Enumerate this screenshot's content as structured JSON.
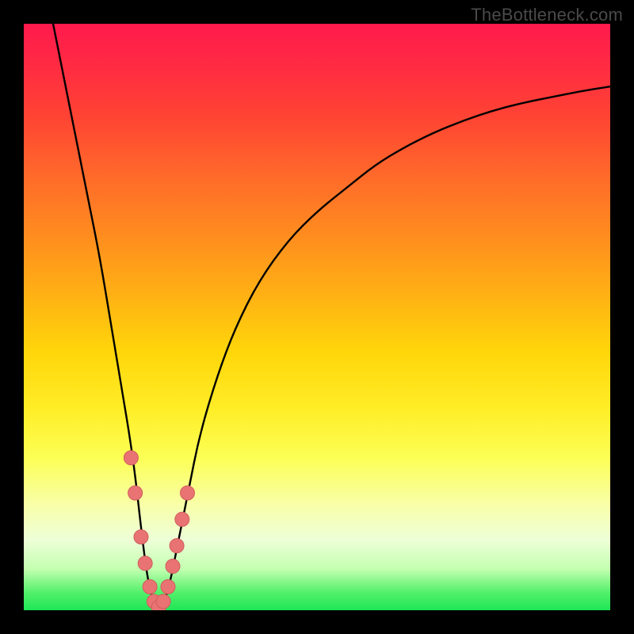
{
  "watermark": "TheBottleneck.com",
  "colors": {
    "frame": "#000000",
    "curve": "#000000",
    "marker_fill": "#e97373",
    "marker_stroke": "#cf5d5d"
  },
  "chart_data": {
    "type": "line",
    "title": "",
    "xlabel": "",
    "ylabel": "",
    "xlim": [
      0,
      100
    ],
    "ylim": [
      0,
      100
    ],
    "grid": false,
    "series": [
      {
        "name": "bottleneck-curve",
        "x_pct": [
          5,
          7,
          9,
          11,
          13,
          15,
          17,
          18,
          19,
          20,
          21,
          22,
          23,
          24,
          25,
          26,
          28,
          30,
          33,
          36,
          40,
          45,
          50,
          55,
          60,
          65,
          70,
          75,
          80,
          85,
          90,
          95,
          100
        ],
        "y_pct": [
          100,
          90,
          80,
          70,
          60,
          48,
          36,
          30,
          23,
          14,
          6,
          1.5,
          0,
          1.5,
          5,
          10,
          20,
          30,
          40,
          48,
          56,
          63,
          68,
          72,
          76,
          79,
          81.5,
          83.5,
          85.2,
          86.5,
          87.5,
          88.5,
          89.3
        ],
        "note": "y_pct is approximate bottleneck percentage read visually; curve reaches 0 at ~23% on x-axis then rises asymptotically."
      }
    ],
    "markers": {
      "name": "data-points",
      "x_pct": [
        18.3,
        19.0,
        20.0,
        20.7,
        21.5,
        22.2,
        23.0,
        23.8,
        24.6,
        25.4,
        26.1,
        27.0,
        27.9
      ],
      "y_pct": [
        26,
        20,
        12.5,
        8,
        4,
        1.5,
        0.5,
        1.5,
        4,
        7.5,
        11,
        15.5,
        20
      ],
      "note": "Salmon dots clustered around curve minimum."
    }
  }
}
